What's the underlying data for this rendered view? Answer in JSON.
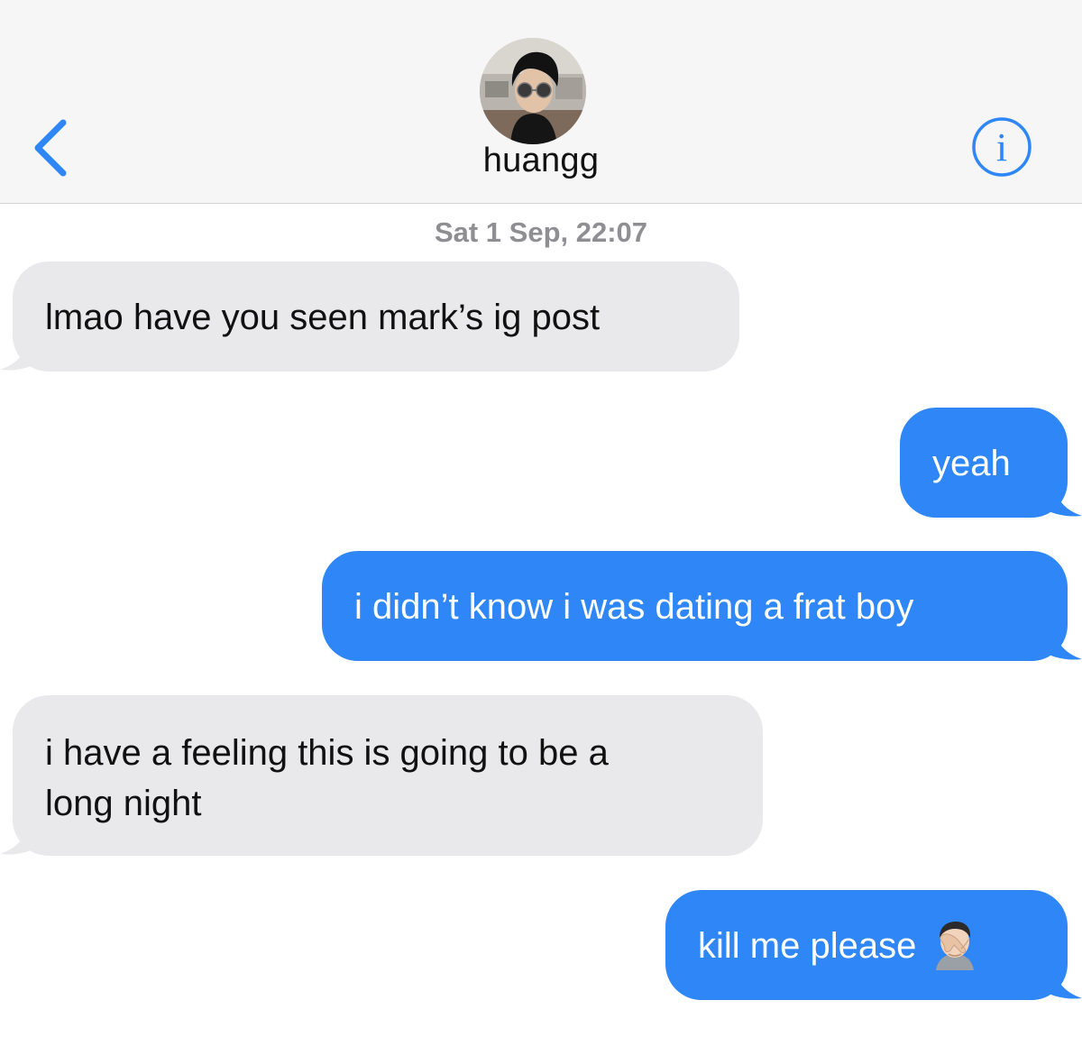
{
  "header": {
    "contact_name": "huangg",
    "back_icon": "chevron-left-icon",
    "info_icon": "info-circle-icon",
    "accent_color": "#2f86f6"
  },
  "conversation": {
    "timestamp": "Sat 1 Sep, 22:07",
    "messages": [
      {
        "direction": "incoming",
        "text": "lmao have you seen mark’s ig post"
      },
      {
        "direction": "outgoing",
        "text": "yeah"
      },
      {
        "direction": "outgoing",
        "text": "i didn’t know i was dating a frat boy"
      },
      {
        "direction": "incoming",
        "line1": "i have a feeling this is going to be a",
        "line2": "long night"
      },
      {
        "direction": "outgoing",
        "text": "kill me please",
        "emoji": "face-palm-emoji"
      }
    ]
  },
  "colors": {
    "incoming_bubble": "#e9e9eb",
    "outgoing_bubble": "#2f86f6",
    "header_background": "#f6f6f6",
    "timestamp_text": "#8e8e93"
  }
}
